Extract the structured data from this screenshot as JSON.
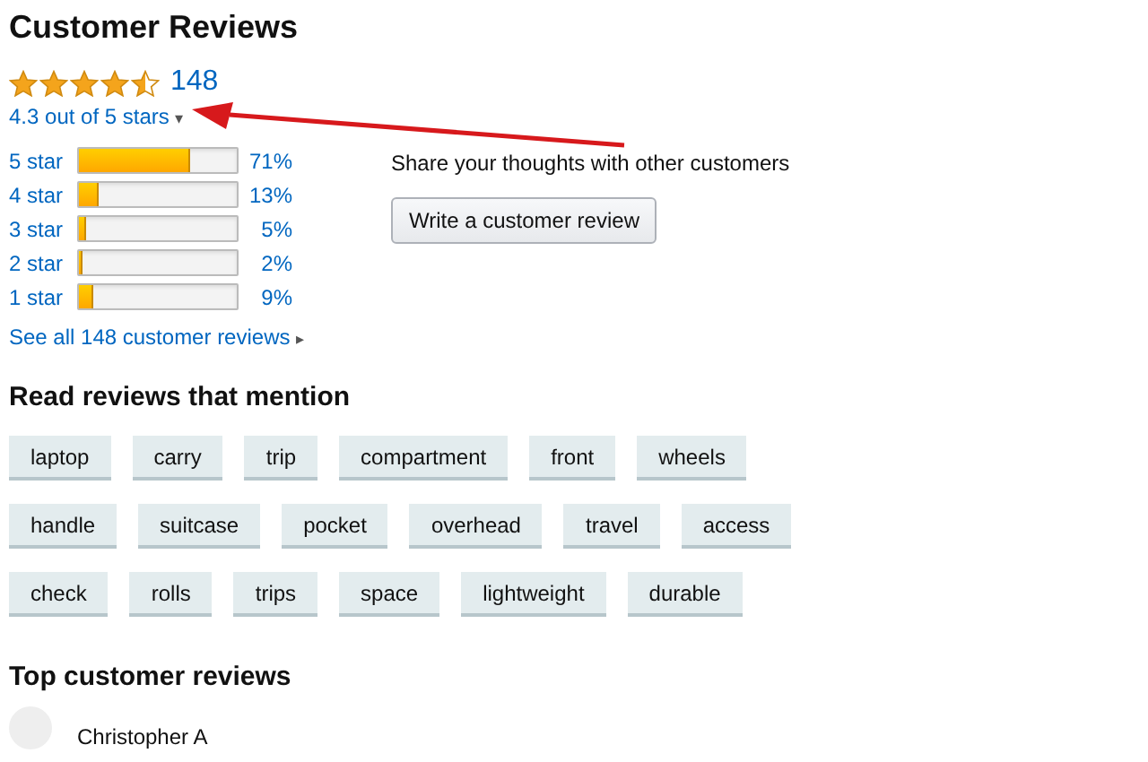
{
  "title": "Customer Reviews",
  "summary": {
    "stars": 4.5,
    "count": "148",
    "rating": "4.3 out of 5 stars",
    "caret": "▾"
  },
  "histogram": [
    {
      "label": "5 star",
      "level": 0.71,
      "percent": "71%"
    },
    {
      "label": "4 star",
      "level": 0.13,
      "percent": "13%"
    },
    {
      "label": "3 star",
      "level": 0.05,
      "percent": "5%"
    },
    {
      "label": "2 star",
      "level": 0.02,
      "percent": "2%"
    },
    {
      "label": "1 star",
      "level": 0.09,
      "percent": "9%"
    }
  ],
  "see_all": {
    "text": "See all 148 customer reviews",
    "caret": "▸"
  },
  "share": {
    "text": "Share your thoughts with other customers",
    "button": "Write a customer review"
  },
  "mentions": {
    "title": "Read reviews that mention",
    "rows": [
      [
        "laptop",
        "carry",
        "trip",
        "compartment",
        "front",
        "wheels"
      ],
      [
        "handle",
        "suitcase",
        "pocket",
        "overhead",
        "travel",
        "access"
      ],
      [
        "check",
        "rolls",
        "trips",
        "space",
        "lightweight",
        "durable"
      ]
    ]
  },
  "top_reviews": {
    "title": "Top customer reviews",
    "reviewer": "Christopher A"
  }
}
